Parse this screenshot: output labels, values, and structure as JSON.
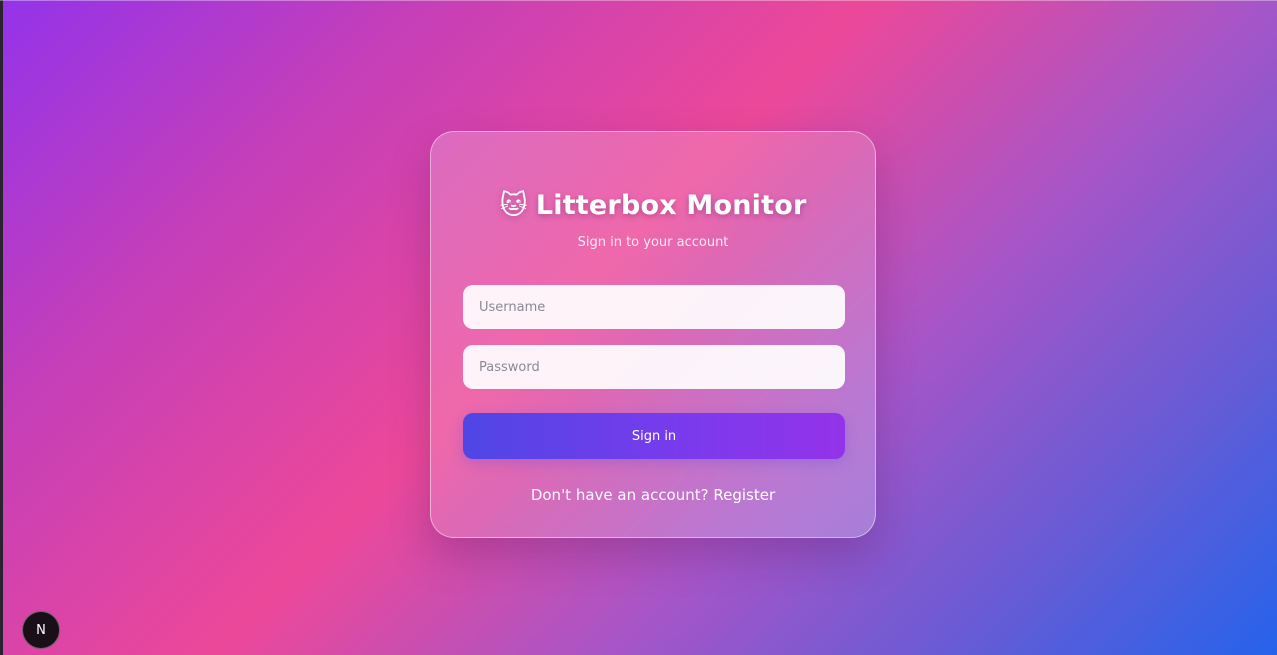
{
  "login": {
    "emoji": "🐱",
    "title": "Litterbox Monitor",
    "subtitle": "Sign in to your account",
    "username_placeholder": "Username",
    "password_placeholder": "Password",
    "signin_label": "Sign in",
    "register_prompt": "Don't have an account?",
    "register_link": "Register"
  },
  "dev_badge": {
    "letter": "N"
  },
  "colors": {
    "gradient_start": "#9333ea",
    "gradient_mid": "#ec4899",
    "gradient_end": "#2563eb",
    "button_start": "#4f46e5",
    "button_end": "#9333ea"
  }
}
